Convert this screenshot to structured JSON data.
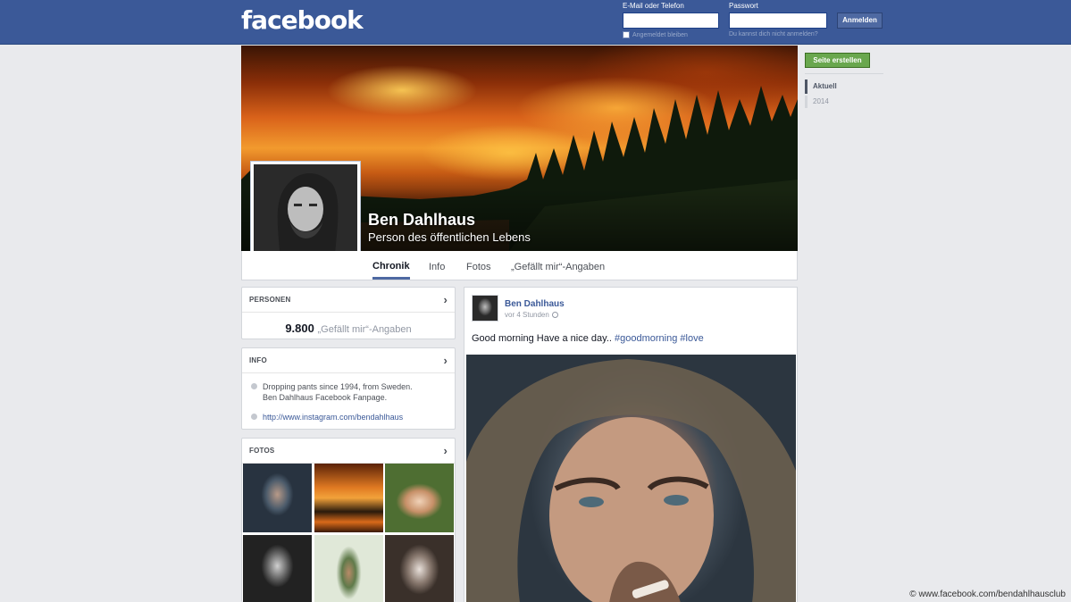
{
  "header": {
    "logo": "facebook",
    "email_label": "E-Mail oder Telefon",
    "password_label": "Passwort",
    "login_button": "Anmelden",
    "remember_label": "Angemeldet bleiben",
    "forgot_label": "Du kannst dich nicht anmelden?"
  },
  "profile": {
    "name": "Ben Dahlhaus",
    "category": "Person des öffentlichen Lebens"
  },
  "tabs": [
    {
      "label": "Chronik",
      "active": true
    },
    {
      "label": "Info",
      "active": false
    },
    {
      "label": "Fotos",
      "active": false
    },
    {
      "label": "„Gefällt mir“-Angaben",
      "active": false
    }
  ],
  "right": {
    "create_page_button": "Seite erstellen",
    "timeline": [
      "Aktuell",
      "2014"
    ]
  },
  "people_box": {
    "title": "PERSONEN",
    "likes_count": "9.800",
    "likes_label": "„Gefällt mir“-Angaben"
  },
  "info_box": {
    "title": "INFO",
    "line1": "Dropping pants since 1994, from Sweden.",
    "line2": "Ben Dahlhaus Facebook Fanpage.",
    "link": "http://www.instagram.com/bendahlhaus"
  },
  "photos_box": {
    "title": "FOTOS"
  },
  "post": {
    "author": "Ben Dahlhaus",
    "time": "vor 4 Stunden",
    "text": "Good morning Have a nice day..",
    "hashtags": [
      "#goodmorning",
      "#love"
    ]
  },
  "credit": "© www.facebook.com/bendahlhausclub",
  "colors": {
    "brand_blue": "#3b5998",
    "create_green": "#69a74e",
    "page_bg": "#e9eaed"
  }
}
